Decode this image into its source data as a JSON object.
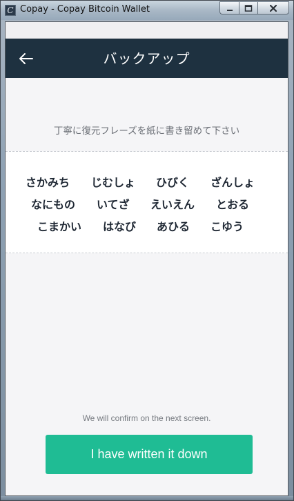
{
  "window": {
    "title": "Copay - Copay Bitcoin Wallet",
    "icon_glyph": "C"
  },
  "header": {
    "title": "バックアップ",
    "back_icon": "arrow-left-icon",
    "background": "#1e3140"
  },
  "instruction": "丁寧に復元フレーズを紙に書き留めて下さい",
  "mnemonic": {
    "rows": [
      [
        "さかみち",
        "じむしょ",
        "ひびく",
        "ざんしょ"
      ],
      [
        "なにもの",
        "いてざ",
        "えいえん",
        "とおる"
      ],
      [
        "こまかい",
        "はなび",
        "あひる",
        "こゆう"
      ]
    ]
  },
  "footer": {
    "note": "We will confirm on the next screen.",
    "button_label": "I have written it down",
    "button_color": "#1fbc94"
  }
}
